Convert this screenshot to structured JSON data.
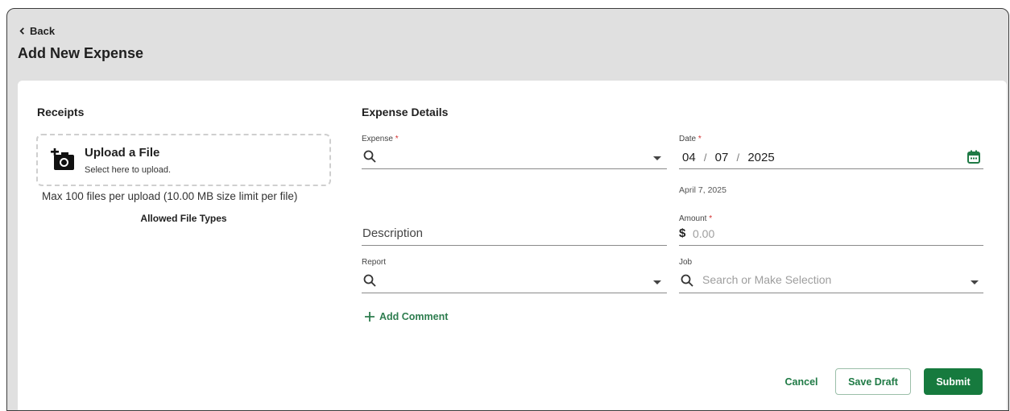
{
  "header": {
    "back_label": "Back",
    "title": "Add New Expense"
  },
  "receipts": {
    "title": "Receipts",
    "upload_title": "Upload a File",
    "upload_subtitle": "Select here to upload.",
    "limit_text": "Max 100 files per upload (10.00 MB size limit per file)",
    "allowed_link": "Allowed File Types"
  },
  "details": {
    "title": "Expense Details",
    "expense": {
      "label": "Expense",
      "required_mark": "*",
      "value": ""
    },
    "date": {
      "label": "Date",
      "required_mark": "*",
      "month": "04",
      "day": "07",
      "year": "2025",
      "separator": "/",
      "hint": "April 7, 2025"
    },
    "description": {
      "placeholder": "Description"
    },
    "amount": {
      "label": "Amount",
      "required_mark": "*",
      "currency": "$",
      "placeholder": "0.00"
    },
    "report": {
      "label": "Report",
      "value": ""
    },
    "job": {
      "label": "Job",
      "placeholder": "Search or Make Selection"
    },
    "add_comment": "Add Comment"
  },
  "actions": {
    "cancel": "Cancel",
    "save_draft": "Save Draft",
    "submit": "Submit"
  },
  "colors": {
    "accent": "#167a3e",
    "required": "#d32f2f"
  },
  "icons": [
    "chevron-left-icon",
    "add-photo-icon",
    "search-icon",
    "caret-down-icon",
    "calendar-icon",
    "plus-icon"
  ]
}
